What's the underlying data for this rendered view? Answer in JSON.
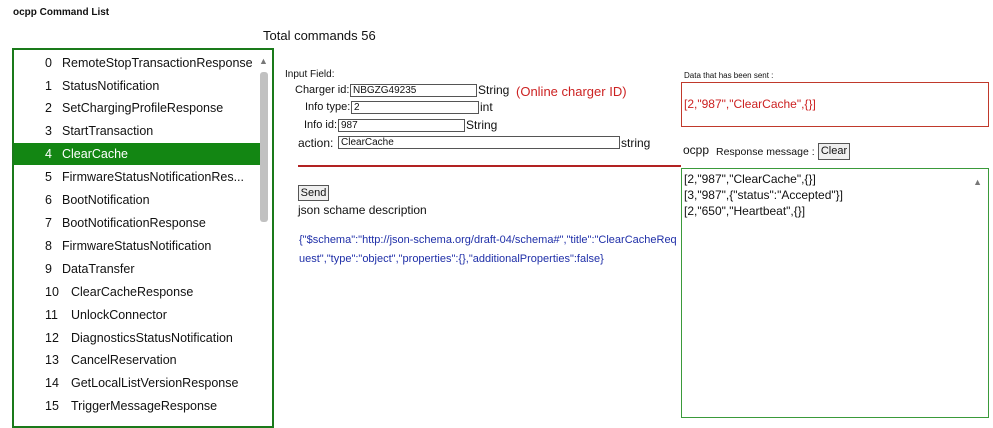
{
  "app": {
    "title": "ocpp Command List"
  },
  "total_commands": "Total commands 56",
  "commands": [
    {
      "num": "0",
      "label": "RemoteStopTransactionResponse"
    },
    {
      "num": "1",
      "label": "StatusNotification"
    },
    {
      "num": "2",
      "label": "SetChargingProfileResponse"
    },
    {
      "num": "3",
      "label": "StartTransaction"
    },
    {
      "num": "4",
      "label": "ClearCache",
      "selected": true
    },
    {
      "num": "5",
      "label": "FirmwareStatusNotificationRes..."
    },
    {
      "num": "6",
      "label": "BootNotification"
    },
    {
      "num": "7",
      "label": "BootNotificationResponse"
    },
    {
      "num": "8",
      "label": "FirmwareStatusNotification"
    },
    {
      "num": "9",
      "label": "DataTransfer"
    },
    {
      "num": "10",
      "label": "ClearCacheResponse"
    },
    {
      "num": "11",
      "label": "UnlockConnector"
    },
    {
      "num": "12",
      "label": "DiagnosticsStatusNotification"
    },
    {
      "num": "13",
      "label": "CancelReservation"
    },
    {
      "num": "14",
      "label": "GetLocalListVersionResponse"
    },
    {
      "num": "15",
      "label": "TriggerMessageResponse"
    }
  ],
  "input_field": {
    "caption": "Input Field:",
    "charger_id": {
      "label": "Charger id:",
      "value": "NBGZG49235",
      "type": "String"
    },
    "info_type": {
      "label": "Info type:",
      "value": "2",
      "type": "int"
    },
    "info_id": {
      "label": "Info id:",
      "value": "987",
      "type": "String"
    },
    "action": {
      "label": "action:",
      "value": "ClearCache",
      "type": "string"
    },
    "online_note": "(Online charger ID)"
  },
  "send_label": "Send",
  "schema": {
    "title": "json schame description",
    "text": "{\"$schema\":\"http://json-schema.org/draft-04/schema#\",\"title\":\"ClearCacheRequest\",\"type\":\"object\",\"properties\":{},\"additionalProperties\":false}"
  },
  "sent": {
    "caption": "Data that has been sent :",
    "data": "[2,\"987\",\"ClearCache\",{}]"
  },
  "response": {
    "prefix": "ocpp",
    "label": "Response message :",
    "clear_label": "Clear",
    "lines": [
      "[2,\"987\",\"ClearCache\",{}]",
      "[3,\"987\",{\"status\":\"Accepted\"}]",
      "[2,\"650\",\"Heartbeat\",{}]"
    ]
  },
  "colors": {
    "selection": "#138613",
    "list_border": "#1a7a1a",
    "alert_red": "#cc2222",
    "schema_blue": "#1f2fa8"
  }
}
